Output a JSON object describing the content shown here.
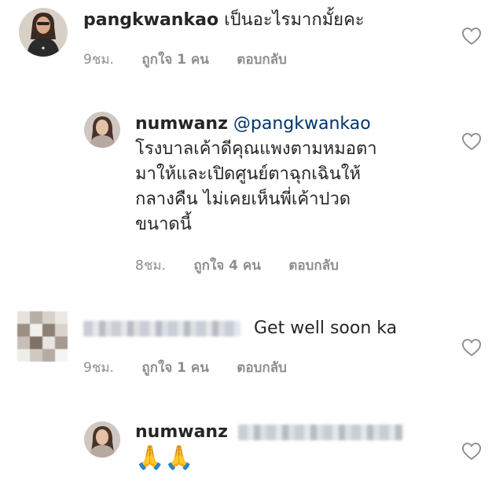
{
  "comments": [
    {
      "username": "pangkwankao",
      "text": "เป็นอะไรมากมั้ยคะ",
      "time": "9ชม.",
      "likes": "ถูกใจ 1 คน",
      "reply_label": "ตอบกลับ"
    },
    {
      "username": "numwanz",
      "mention": "@pangkwankao",
      "text_lines": [
        "โรงบาลเค้าดีคุณแพงตามหมอตา",
        "มาให้และเปิดศูนย์ตาฉุกเฉินให้",
        "กลางคืน ไม่เคยเห็นพี่เค้าปวด",
        "ขนาดนี้"
      ],
      "time": "8ชม.",
      "likes": "ถูกใจ 4 คน",
      "reply_label": "ตอบกลับ"
    },
    {
      "username": "",
      "text": "Get well soon ka",
      "time": "9ชม.",
      "likes": "ถูกใจ 1 คน",
      "reply_label": "ตอบกลับ"
    },
    {
      "username": "numwanz",
      "text": "🙏🙏"
    }
  ],
  "icons": {
    "heart": "heart-outline-icon"
  },
  "colors": {
    "text": "#262626",
    "meta": "#8e8e8e",
    "mention": "#003569"
  }
}
